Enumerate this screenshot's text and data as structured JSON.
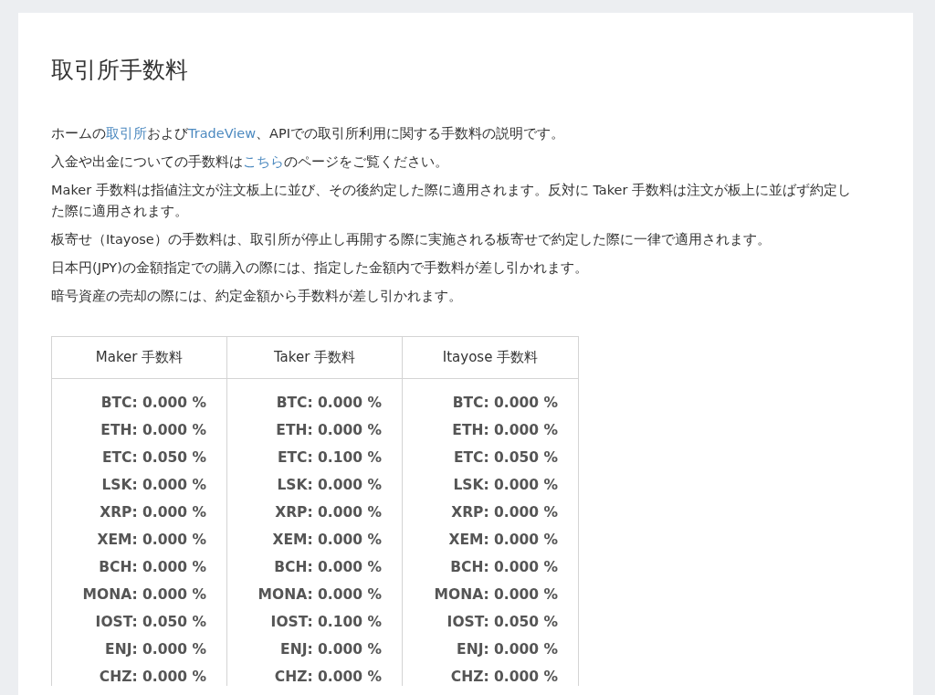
{
  "title": "取引所手数料",
  "paragraphs": [
    [
      {
        "text": "ホームの",
        "link": false
      },
      {
        "text": "取引所",
        "link": true
      },
      {
        "text": "および",
        "link": false
      },
      {
        "text": "TradeView",
        "link": true
      },
      {
        "text": "、APIでの取引所利用に関する手数料の説明です。",
        "link": false
      }
    ],
    [
      {
        "text": "入金や出金についての手数料は",
        "link": false
      },
      {
        "text": "こちら",
        "link": true
      },
      {
        "text": "のページをご覧ください。",
        "link": false
      }
    ],
    [
      {
        "text": "Maker 手数料は指値注文が注文板上に並び、その後約定した際に適用されます。反対に Taker 手数料は注文が板上に並ばず約定した際に適用されます。",
        "link": false
      }
    ],
    [
      {
        "text": "板寄せ（Itayose）の手数料は、取引所が停止し再開する際に実施される板寄せで約定した際に一律で適用されます。",
        "link": false
      }
    ],
    [
      {
        "text": "日本円(JPY)の金額指定での購入の際には、指定した金額内で手数料が差し引かれます。",
        "link": false
      }
    ],
    [
      {
        "text": "暗号資産の売却の際には、約定金額から手数料が差し引かれます。",
        "link": false
      }
    ]
  ],
  "table": {
    "columns": [
      "Maker 手数料",
      "Taker 手数料",
      "Itayose 手数料"
    ],
    "rows": [
      [
        "BTC: 0.000 %",
        "BTC: 0.000 %",
        "BTC: 0.000 %"
      ],
      [
        "ETH: 0.000 %",
        "ETH: 0.000 %",
        "ETH: 0.000 %"
      ],
      [
        "ETC: 0.050 %",
        "ETC: 0.100 %",
        "ETC: 0.050 %"
      ],
      [
        "LSK: 0.000 %",
        "LSK: 0.000 %",
        "LSK: 0.000 %"
      ],
      [
        "XRP: 0.000 %",
        "XRP: 0.000 %",
        "XRP: 0.000 %"
      ],
      [
        "XEM: 0.000 %",
        "XEM: 0.000 %",
        "XEM: 0.000 %"
      ],
      [
        "BCH: 0.000 %",
        "BCH: 0.000 %",
        "BCH: 0.000 %"
      ],
      [
        "MONA: 0.000 %",
        "MONA: 0.000 %",
        "MONA: 0.000 %"
      ],
      [
        "IOST: 0.050 %",
        "IOST: 0.100 %",
        "IOST: 0.050 %"
      ],
      [
        "ENJ: 0.000 %",
        "ENJ: 0.000 %",
        "ENJ: 0.000 %"
      ],
      [
        "CHZ: 0.000 %",
        "CHZ: 0.000 %",
        "CHZ: 0.000 %"
      ]
    ]
  }
}
